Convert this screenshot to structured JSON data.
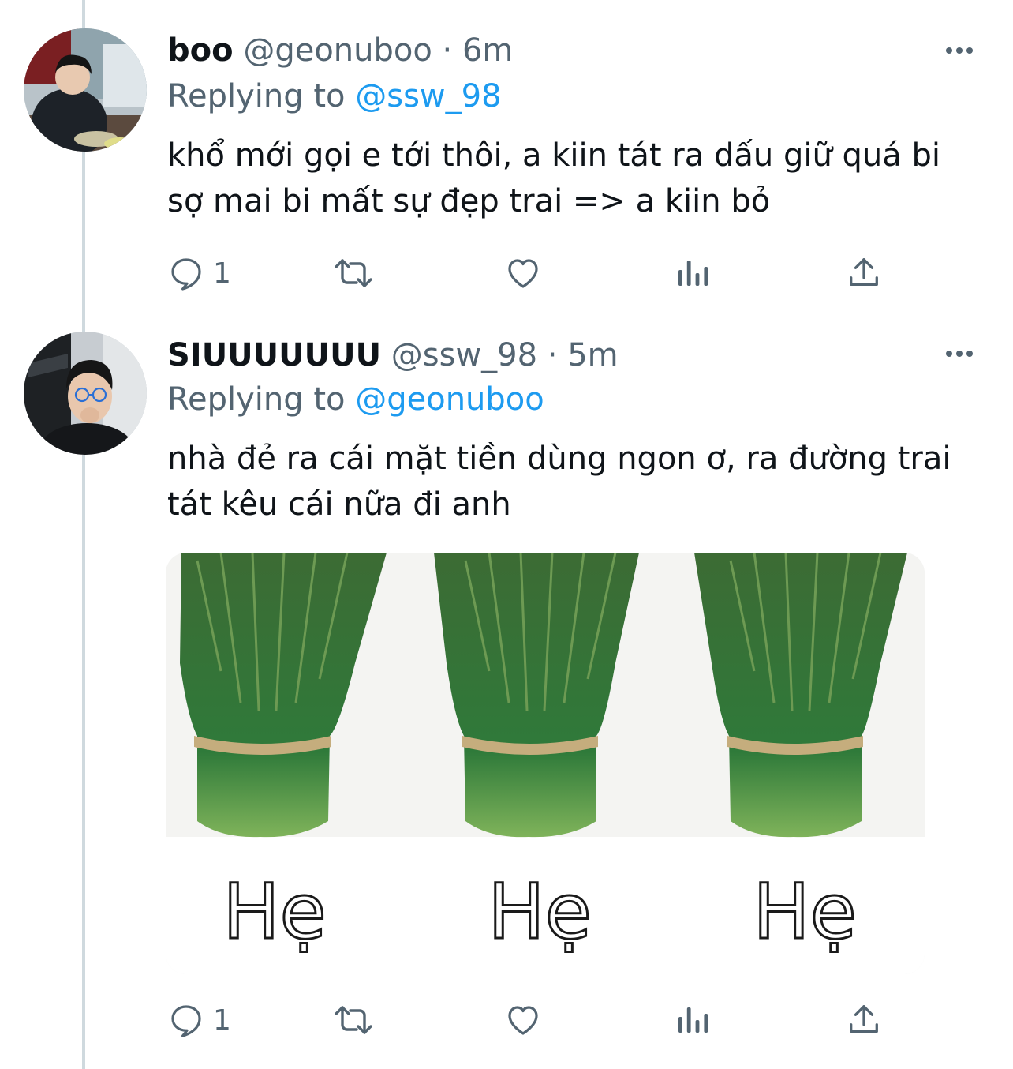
{
  "tweets": [
    {
      "display_name": "boo",
      "handle": "@geonuboo",
      "separator": "·",
      "time": "6m",
      "replying_label": "Replying to",
      "replying_to": "@ssw_98",
      "text": "khổ mới gọi e tới thôi, a kiin tát ra dấu giữ quá bi sợ mai bi mất sự đẹp trai => a kiin bỏ",
      "reply_count": "1",
      "avatar_icon": "avatar-photo"
    },
    {
      "display_name": "SIUUUUUUU",
      "handle": "@ssw_98",
      "separator": "·",
      "time": "5m",
      "replying_label": "Replying to",
      "replying_to": "@geonuboo",
      "text": "nhà đẻ ra cái mặt tiền dùng ngon ơ, ra đường trai tát kêu cái nữa đi anh",
      "reply_count": "1",
      "avatar_icon": "avatar-photo",
      "media": {
        "captions": [
          "Hẹ",
          "Hẹ",
          "Hẹ"
        ]
      }
    }
  ],
  "colors": {
    "accent": "#1d9bf0",
    "secondary_text": "#536471",
    "primary_text": "#0f1419",
    "thread_line": "#cfd9de"
  }
}
